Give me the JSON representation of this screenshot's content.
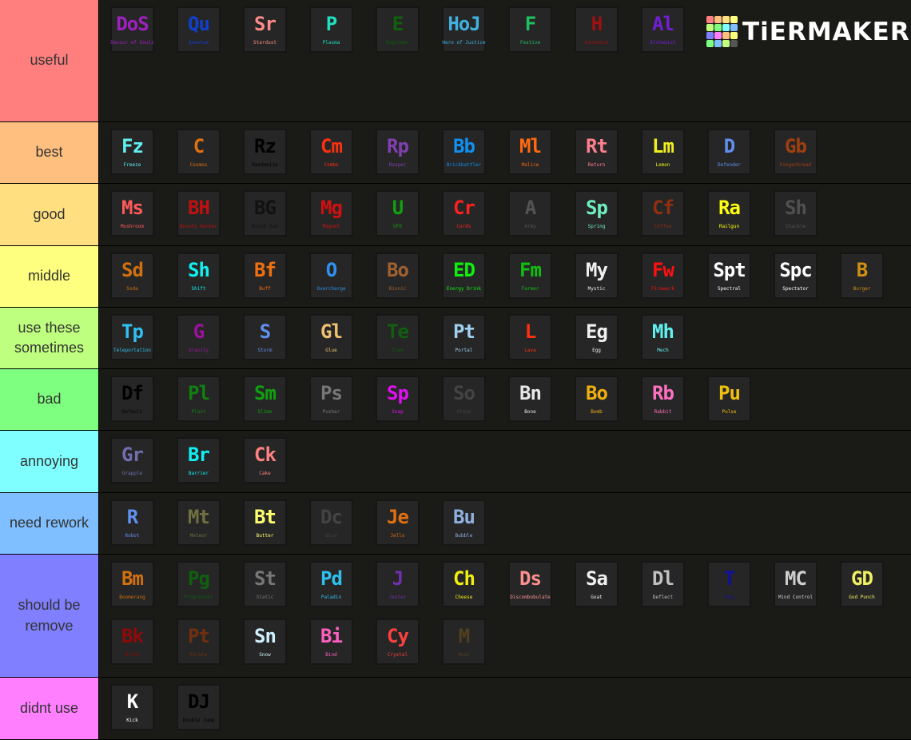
{
  "logo": {
    "text": "TiERMAKER",
    "colors": [
      "#ff7f7f",
      "#ffbf7f",
      "#ffdf7f",
      "#ffff7f",
      "#bfff7f",
      "#7fff7f",
      "#7fffff",
      "#7fbfff",
      "#7f7fff",
      "#ff7fff",
      "#ffbf7f",
      "#ffff7f",
      "#7fff7f",
      "#7fbfff",
      "#bfff7f",
      "#555555"
    ]
  },
  "tiers": [
    {
      "label": "useful",
      "color": "#ff7f7f",
      "height": 153,
      "items": [
        {
          "abbr": "DoS",
          "name": "Devour of Souls",
          "color": "#a020c0"
        },
        {
          "abbr": "Qu",
          "name": "Quantum",
          "color": "#1040d0"
        },
        {
          "abbr": "Sr",
          "name": "Stardust",
          "color": "#ff8a8a"
        },
        {
          "abbr": "P",
          "name": "Plasma",
          "color": "#20e0c0"
        },
        {
          "abbr": "E",
          "name": "Engineer",
          "color": "#106010"
        },
        {
          "abbr": "HoJ",
          "name": "Hero of Justice",
          "color": "#40b0e0"
        },
        {
          "abbr": "F",
          "name": "Festive",
          "color": "#20c060"
        },
        {
          "abbr": "H",
          "name": "Hivemind",
          "color": "#a01010"
        },
        {
          "abbr": "Al",
          "name": "Alchemist",
          "color": "#7020d0"
        }
      ]
    },
    {
      "label": "best",
      "color": "#ffbf7f",
      "height": 77,
      "items": [
        {
          "abbr": "Fz",
          "name": "Freeze",
          "color": "#60f0f0"
        },
        {
          "abbr": "C",
          "name": "Cosmos",
          "color": "#e07010"
        },
        {
          "abbr": "Rz",
          "name": "Randomize",
          "color": "#000000"
        },
        {
          "abbr": "Cm",
          "name": "Combo",
          "color": "#ff3010"
        },
        {
          "abbr": "Rp",
          "name": "Reaper",
          "color": "#8040b0"
        },
        {
          "abbr": "Bb",
          "name": "Brickbattler",
          "color": "#1090f0"
        },
        {
          "abbr": "Ml",
          "name": "Malice",
          "color": "#ff6a10"
        },
        {
          "abbr": "Rt",
          "name": "Return",
          "color": "#ff7f8f"
        },
        {
          "abbr": "Lm",
          "name": "Lemon",
          "color": "#f0f020"
        },
        {
          "abbr": "D",
          "name": "Defender",
          "color": "#6090f0"
        },
        {
          "abbr": "Gb",
          "name": "Gingerbread",
          "color": "#a04010"
        }
      ]
    },
    {
      "label": "good",
      "color": "#ffdf7f",
      "height": 78,
      "items": [
        {
          "abbr": "Ms",
          "name": "Mushroom",
          "color": "#ff5a5a"
        },
        {
          "abbr": "BH",
          "name": "Bounty Hunter",
          "color": "#c01010"
        },
        {
          "abbr": "BG",
          "name": "Blood God",
          "color": "#111111"
        },
        {
          "abbr": "Mg",
          "name": "Magnet",
          "color": "#d01010"
        },
        {
          "abbr": "U",
          "name": "UFO",
          "color": "#10a010"
        },
        {
          "abbr": "Cr",
          "name": "Cards",
          "color": "#ff2020"
        },
        {
          "abbr": "A",
          "name": "Army",
          "color": "#555555"
        },
        {
          "abbr": "Sp",
          "name": "Spring",
          "color": "#70f0c0"
        },
        {
          "abbr": "Cf",
          "name": "Coffee",
          "color": "#903010"
        },
        {
          "abbr": "Ra",
          "name": "Railgun",
          "color": "#ffff10"
        },
        {
          "abbr": "Sh",
          "name": "Shackle",
          "color": "#505050"
        }
      ]
    },
    {
      "label": "middle",
      "color": "#ffff7f",
      "height": 77,
      "items": [
        {
          "abbr": "Sd",
          "name": "Soda",
          "color": "#d07010"
        },
        {
          "abbr": "Sh",
          "name": "Shift",
          "color": "#10f0f0"
        },
        {
          "abbr": "Bf",
          "name": "Buff",
          "color": "#f07010"
        },
        {
          "abbr": "O",
          "name": "Overcharge",
          "color": "#3090f0"
        },
        {
          "abbr": "Bo",
          "name": "Bionic",
          "color": "#a06030"
        },
        {
          "abbr": "ED",
          "name": "Energy Drink",
          "color": "#10f010"
        },
        {
          "abbr": "Fm",
          "name": "Farmer",
          "color": "#10c010"
        },
        {
          "abbr": "My",
          "name": "Mystic",
          "color": "#f0f0f0"
        },
        {
          "abbr": "Fw",
          "name": "Firework",
          "color": "#ff1010"
        },
        {
          "abbr": "Spt",
          "name": "Spectral",
          "color": "#ffffff"
        },
        {
          "abbr": "Spc",
          "name": "Spectator",
          "color": "#ffffff"
        },
        {
          "abbr": "B",
          "name": "Burger",
          "color": "#d09010"
        }
      ]
    },
    {
      "label": "use these sometimes",
      "color": "#bfff7f",
      "height": 77,
      "items": [
        {
          "abbr": "Tp",
          "name": "Teleportation",
          "color": "#30c0f0"
        },
        {
          "abbr": "G",
          "name": "Gravity",
          "color": "#a010a0"
        },
        {
          "abbr": "S",
          "name": "Storm",
          "color": "#6090f0"
        },
        {
          "abbr": "Gl",
          "name": "Glue",
          "color": "#f0c070"
        },
        {
          "abbr": "Te",
          "name": "Tree",
          "color": "#106010"
        },
        {
          "abbr": "Pt",
          "name": "Portal",
          "color": "#a0d0f0"
        },
        {
          "abbr": "L",
          "name": "Lava",
          "color": "#ff3010"
        },
        {
          "abbr": "Eg",
          "name": "Egg",
          "color": "#f0f0f0"
        },
        {
          "abbr": "Mh",
          "name": "Mech",
          "color": "#60f0f0"
        }
      ]
    },
    {
      "label": "bad",
      "color": "#7fff7f",
      "height": 77,
      "items": [
        {
          "abbr": "Df",
          "name": "Default",
          "color": "#000000"
        },
        {
          "abbr": "Pl",
          "name": "Plant",
          "color": "#108010"
        },
        {
          "abbr": "Sm",
          "name": "Slime",
          "color": "#10a010"
        },
        {
          "abbr": "Ps",
          "name": "Pusher",
          "color": "#777777"
        },
        {
          "abbr": "Sp",
          "name": "Soap",
          "color": "#e010f0"
        },
        {
          "abbr": "So",
          "name": "Stone",
          "color": "#444444"
        },
        {
          "abbr": "Bn",
          "name": "Bone",
          "color": "#e8e8e8"
        },
        {
          "abbr": "Bo",
          "name": "Bomb",
          "color": "#f0b010"
        },
        {
          "abbr": "Rb",
          "name": "Rabbit",
          "color": "#ff70c0"
        },
        {
          "abbr": "Pu",
          "name": "Pulse",
          "color": "#f0c010"
        }
      ]
    },
    {
      "label": "annoying",
      "color": "#7fffff",
      "height": 78,
      "items": [
        {
          "abbr": "Gr",
          "name": "Grapple",
          "color": "#7070b0"
        },
        {
          "abbr": "Br",
          "name": "Barrier",
          "color": "#10f0f0"
        },
        {
          "abbr": "Ck",
          "name": "Cake",
          "color": "#ff8080"
        }
      ]
    },
    {
      "label": "need rework",
      "color": "#7fbfff",
      "height": 77,
      "items": [
        {
          "abbr": "R",
          "name": "Robot",
          "color": "#6090f0"
        },
        {
          "abbr": "Mt",
          "name": "Meteor",
          "color": "#707040"
        },
        {
          "abbr": "Bt",
          "name": "Butter",
          "color": "#ffff70"
        },
        {
          "abbr": "Dc",
          "name": "Dice",
          "color": "#444444"
        },
        {
          "abbr": "Je",
          "name": "Jello",
          "color": "#e07010"
        },
        {
          "abbr": "Bu",
          "name": "Bubble",
          "color": "#90b0e0"
        }
      ]
    },
    {
      "label": "should be remove",
      "color": "#7f7fff",
      "height": 154,
      "items": [
        {
          "abbr": "Bm",
          "name": "Boomerang",
          "color": "#d07010"
        },
        {
          "abbr": "Pg",
          "name": "Progressor",
          "color": "#106010"
        },
        {
          "abbr": "St",
          "name": "Static",
          "color": "#777777"
        },
        {
          "abbr": "Pd",
          "name": "Paladin",
          "color": "#30c0f0"
        },
        {
          "abbr": "J",
          "name": "Jester",
          "color": "#7030b0"
        },
        {
          "abbr": "Ch",
          "name": "Cheese",
          "color": "#f0f010"
        },
        {
          "abbr": "Ds",
          "name": "Discombobulate",
          "color": "#ff9090"
        },
        {
          "abbr": "Sa",
          "name": "Goat",
          "color": "#f0f0f0"
        },
        {
          "abbr": "Dl",
          "name": "Deflect",
          "color": "#c0c0c0"
        },
        {
          "abbr": "T",
          "name": "Tiny",
          "color": "#1010a0"
        },
        {
          "abbr": "MC",
          "name": "Mind Control",
          "color": "#d0d0d0"
        },
        {
          "abbr": "GD",
          "name": "God Punch",
          "color": "#f0f060"
        },
        {
          "abbr": "Bk",
          "name": "Brick",
          "color": "#900a0a"
        },
        {
          "abbr": "Pt",
          "name": "Pirate",
          "color": "#703010"
        },
        {
          "abbr": "Sn",
          "name": "Snow",
          "color": "#d0f0ff"
        },
        {
          "abbr": "Bi",
          "name": "Bind",
          "color": "#ff60c0"
        },
        {
          "abbr": "Cy",
          "name": "Crystal",
          "color": "#ff4040"
        },
        {
          "abbr": "M",
          "name": "Moai",
          "color": "#504020"
        }
      ]
    },
    {
      "label": "didnt use",
      "color": "#ff7fff",
      "height": 78,
      "items": [
        {
          "abbr": "K",
          "name": "Kick",
          "color": "#ffffff"
        },
        {
          "abbr": "DJ",
          "name": "Double Jump",
          "color": "#000000"
        }
      ]
    }
  ]
}
